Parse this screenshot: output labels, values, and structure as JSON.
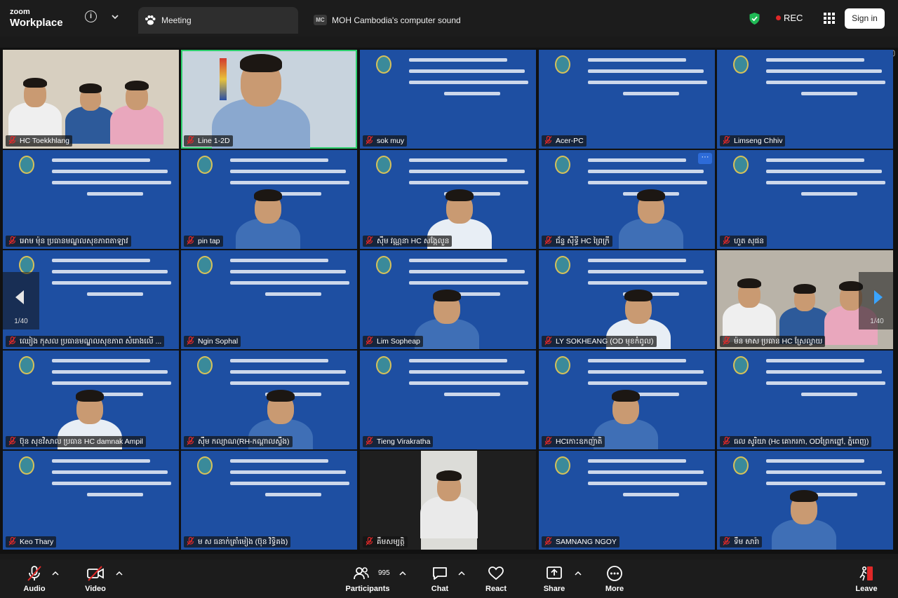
{
  "app": {
    "brand_top": "zoom",
    "brand_bottom": "Workplace"
  },
  "topbar": {
    "meeting_tab": "Meeting",
    "sound_tab_badge": "MC",
    "sound_tab_label": "MOH Cambodia's computer sound",
    "rec_label": "REC",
    "sign_in_label": "Sign in",
    "info_label": "i"
  },
  "pager": {
    "left_count": "1/40",
    "right_count": "1/40"
  },
  "participants": [
    {
      "name": "HC Toekkhlang",
      "kind": "camera-group"
    },
    {
      "name": "Line 1-2D",
      "kind": "camera-speaker",
      "active": true
    },
    {
      "name": "sok muy",
      "kind": "slide"
    },
    {
      "name": "Acer-PC",
      "kind": "slide"
    },
    {
      "name": "Limseng Chhiv",
      "kind": "slide"
    },
    {
      "name": "អោម ម៉ុន ប្រធានមណ្ឌលសុខភាពតាឡាវ",
      "kind": "slide"
    },
    {
      "name": "pin tap",
      "kind": "slide-person"
    },
    {
      "name": "ស៊ឹម វណ្ណនា HC សង្កែលួន",
      "kind": "slide-person"
    },
    {
      "name": "ជ័ន្ទ សុីទ្ធី HC ព្រៃក្រី",
      "kind": "slide-person",
      "menu": true
    },
    {
      "name": "ហួត សុផន",
      "kind": "slide"
    },
    {
      "name": "ឈៀង កុសល ប្រធានមណ្ឌលសុខភាព សំរោងលើ ...",
      "kind": "slide"
    },
    {
      "name": "Ngin Sophal",
      "kind": "slide"
    },
    {
      "name": "Lim Sopheap",
      "kind": "slide-person"
    },
    {
      "name": "LY SOKHEANG (OD មុខកំពូល)",
      "kind": "slide-person"
    },
    {
      "name": "ម៉ន មាស ប្រធាន HC ស្រែល្វាយ",
      "kind": "camera-group"
    },
    {
      "name": "ប៊ុន សុខវិសាល ប្រធាន HC damnak Ampil",
      "kind": "slide-person"
    },
    {
      "name": "ស៊ឹម កល្យាណ(RH-កណ្ដាលស្ទឹង)",
      "kind": "slide-person"
    },
    {
      "name": "Tieng Virakratha",
      "kind": "slide"
    },
    {
      "name": "HCកោះឧកញ៉ាតិ",
      "kind": "slide-person"
    },
    {
      "name": "ធល សូរិយា (Hc គោករកា, ODព្រែកព្នៅ, ភ្នំពេញ)",
      "kind": "slide"
    },
    {
      "name": "Keo Thary",
      "kind": "slide"
    },
    {
      "name": "ម ស ធនាក់គ្រាំមៀង (ប៊ុន វិទ្ធិគង)",
      "kind": "slide"
    },
    {
      "name": "គឹមសម្បត្តិ",
      "kind": "camera-single"
    },
    {
      "name": "SAMNANG NGOY",
      "kind": "slide"
    },
    {
      "name": "ទឹម សារ៉ា",
      "kind": "slide-person"
    }
  ],
  "toolbar": {
    "audio": "Audio",
    "video": "Video",
    "participants": "Participants",
    "participants_count": "995",
    "chat": "Chat",
    "react": "React",
    "share": "Share",
    "more": "More",
    "leave": "Leave"
  },
  "colors": {
    "slide_bg": "#1e4fa2",
    "active_border": "#2fd06f",
    "rec_dot": "#e02828",
    "leave": "#e02828",
    "muted": "#e02828"
  },
  "icons": [
    "info-icon",
    "chevron-down-icon",
    "paw-icon",
    "shield-check-icon",
    "apps-grid-icon",
    "microphone-muted-icon",
    "video-off-icon",
    "participants-icon",
    "chat-icon",
    "heart-icon",
    "share-screen-icon",
    "more-icon",
    "leave-icon",
    "arrow-left-icon",
    "arrow-right-icon"
  ]
}
